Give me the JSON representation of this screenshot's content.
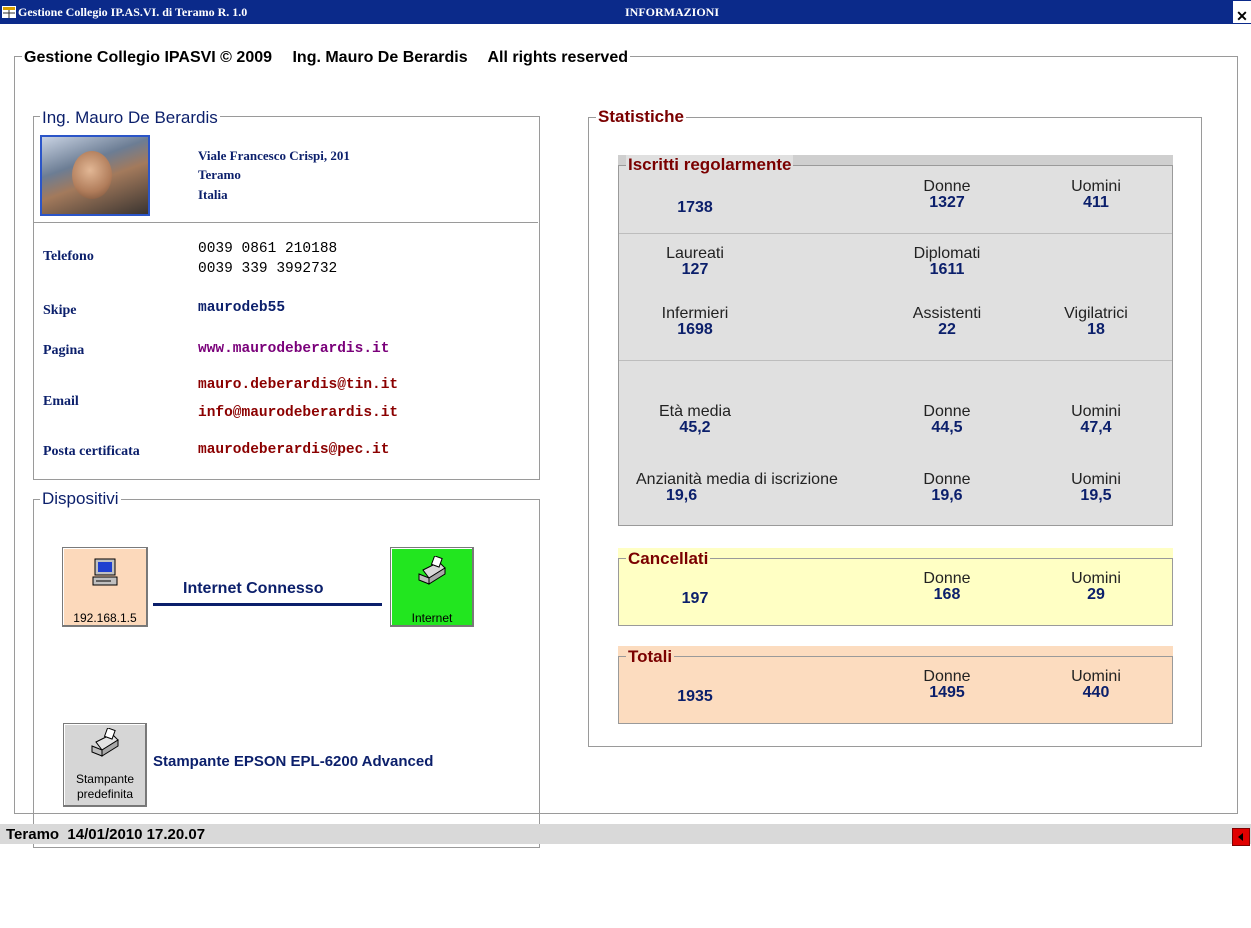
{
  "window": {
    "app_title": "Gestione Collegio IP.AS.VI. di Teramo R. 1.0",
    "center_title": "INFORMAZIONI",
    "close_label": "x"
  },
  "header": {
    "product": "Gestione Collegio IPASVI © 2009",
    "author": "Ing. Mauro De Berardis",
    "rights": "All rights reserved"
  },
  "contact": {
    "legend": "Ing. Mauro De Berardis",
    "address": [
      "Viale Francesco Crispi, 201",
      "Teramo",
      "Italia"
    ],
    "telefono_label": "Telefono",
    "telefono": [
      "0039 0861 210188",
      "0039 339 3992732"
    ],
    "skipe_label": "Skipe",
    "skipe": "maurodeb55",
    "pagina_label": "Pagina",
    "pagina": "www.maurodeberardis.it",
    "email_label": "Email",
    "email": [
      "mauro.deberardis@tin.it",
      "info@maurodeberardis.it"
    ],
    "pec_label": "Posta certificata",
    "pec": "maurodeberardis@pec.it"
  },
  "devices": {
    "legend": "Dispositivi",
    "pc_caption": "192.168.1.5",
    "connection": "Internet Connesso",
    "internet_caption": "Internet",
    "printer_caption_1": "Stampante",
    "printer_caption_2": "predefinita",
    "printer_name": "Stampante EPSON EPL-6200 Advanced"
  },
  "stats": {
    "legend": "Statistiche",
    "iscritti": {
      "legend": "Iscritti regolarmente",
      "total": "1738",
      "donne_label": "Donne",
      "donne": "1327",
      "uomini_label": "Uomini",
      "uomini": "411",
      "laureati_label": "Laureati",
      "laureati": "127",
      "diplomati_label": "Diplomati",
      "diplomati": "1611",
      "infermieri_label": "Infermieri",
      "infermieri": "1698",
      "assistenti_label": "Assistenti",
      "assistenti": "22",
      "vigilatrici_label": "Vigilatrici",
      "vigilatrici": "18",
      "eta_label": "Età media",
      "eta": "45,2",
      "eta_donne_label": "Donne",
      "eta_donne": "44,5",
      "eta_uomini_label": "Uomini",
      "eta_uomini": "47,4",
      "anz_label": "Anzianità media di iscrizione",
      "anz": "19,6",
      "anz_donne_label": "Donne",
      "anz_donne": "19,6",
      "anz_uomini_label": "Uomini",
      "anz_uomini": "19,5"
    },
    "cancellati": {
      "legend": "Cancellati",
      "total": "197",
      "donne_label": "Donne",
      "donne": "168",
      "uomini_label": "Uomini",
      "uomini": "29"
    },
    "totali": {
      "legend": "Totali",
      "total": "1935",
      "donne_label": "Donne",
      "donne": "1495",
      "uomini_label": "Uomini",
      "uomini": "440"
    }
  },
  "statusbar": {
    "text": "Teramo  14/01/2010 17.20.07"
  },
  "colors": {
    "titlebar": "#0b2a8a",
    "navy_text": "#0b1f6b",
    "dark_red": "#7a0000",
    "iscritti_bg": "#e0e0e0",
    "cancellati_bg": "#ffffc4",
    "totali_bg": "#fcdcbf",
    "internet_btn": "#22e61f",
    "pc_btn": "#fcd9bb"
  }
}
